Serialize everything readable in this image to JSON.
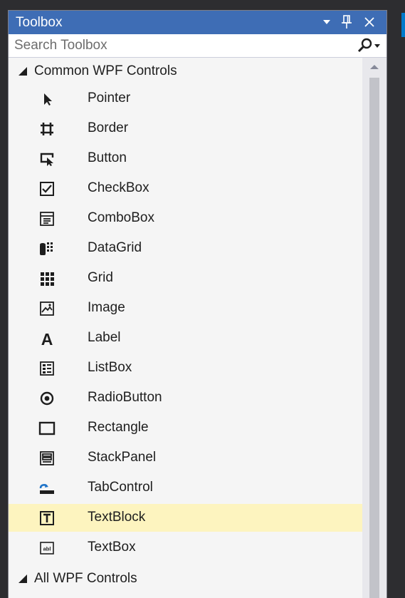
{
  "toolbox": {
    "title": "Toolbox",
    "buttons": {
      "dropdown_icon": "dropdown-arrow-icon",
      "pin_icon": "pin-icon",
      "close_icon": "close-icon"
    },
    "search": {
      "placeholder": "Search Toolbox",
      "icon": "search-icon"
    }
  },
  "groups": [
    {
      "label": "Common WPF Controls",
      "expanded": true,
      "items": [
        {
          "label": "Pointer",
          "icon": "pointer-icon"
        },
        {
          "label": "Border",
          "icon": "border-icon"
        },
        {
          "label": "Button",
          "icon": "button-icon"
        },
        {
          "label": "CheckBox",
          "icon": "checkbox-icon"
        },
        {
          "label": "ComboBox",
          "icon": "combobox-icon"
        },
        {
          "label": "DataGrid",
          "icon": "datagrid-icon"
        },
        {
          "label": "Grid",
          "icon": "grid-icon"
        },
        {
          "label": "Image",
          "icon": "image-icon"
        },
        {
          "label": "Label",
          "icon": "label-icon"
        },
        {
          "label": "ListBox",
          "icon": "listbox-icon"
        },
        {
          "label": "RadioButton",
          "icon": "radiobutton-icon"
        },
        {
          "label": "Rectangle",
          "icon": "rectangle-icon"
        },
        {
          "label": "StackPanel",
          "icon": "stackpanel-icon"
        },
        {
          "label": "TabControl",
          "icon": "tabcontrol-icon"
        },
        {
          "label": "TextBlock",
          "icon": "textblock-icon",
          "selected": true
        },
        {
          "label": "TextBox",
          "icon": "textbox-icon"
        }
      ]
    },
    {
      "label": "All WPF Controls",
      "expanded": true
    }
  ],
  "colors": {
    "title_bar": "#3e6db5",
    "chrome": "#2d2d30",
    "panel_bg": "#f5f5f5",
    "selected_item": "#fdf4bf",
    "text": "#1e1e1e"
  }
}
